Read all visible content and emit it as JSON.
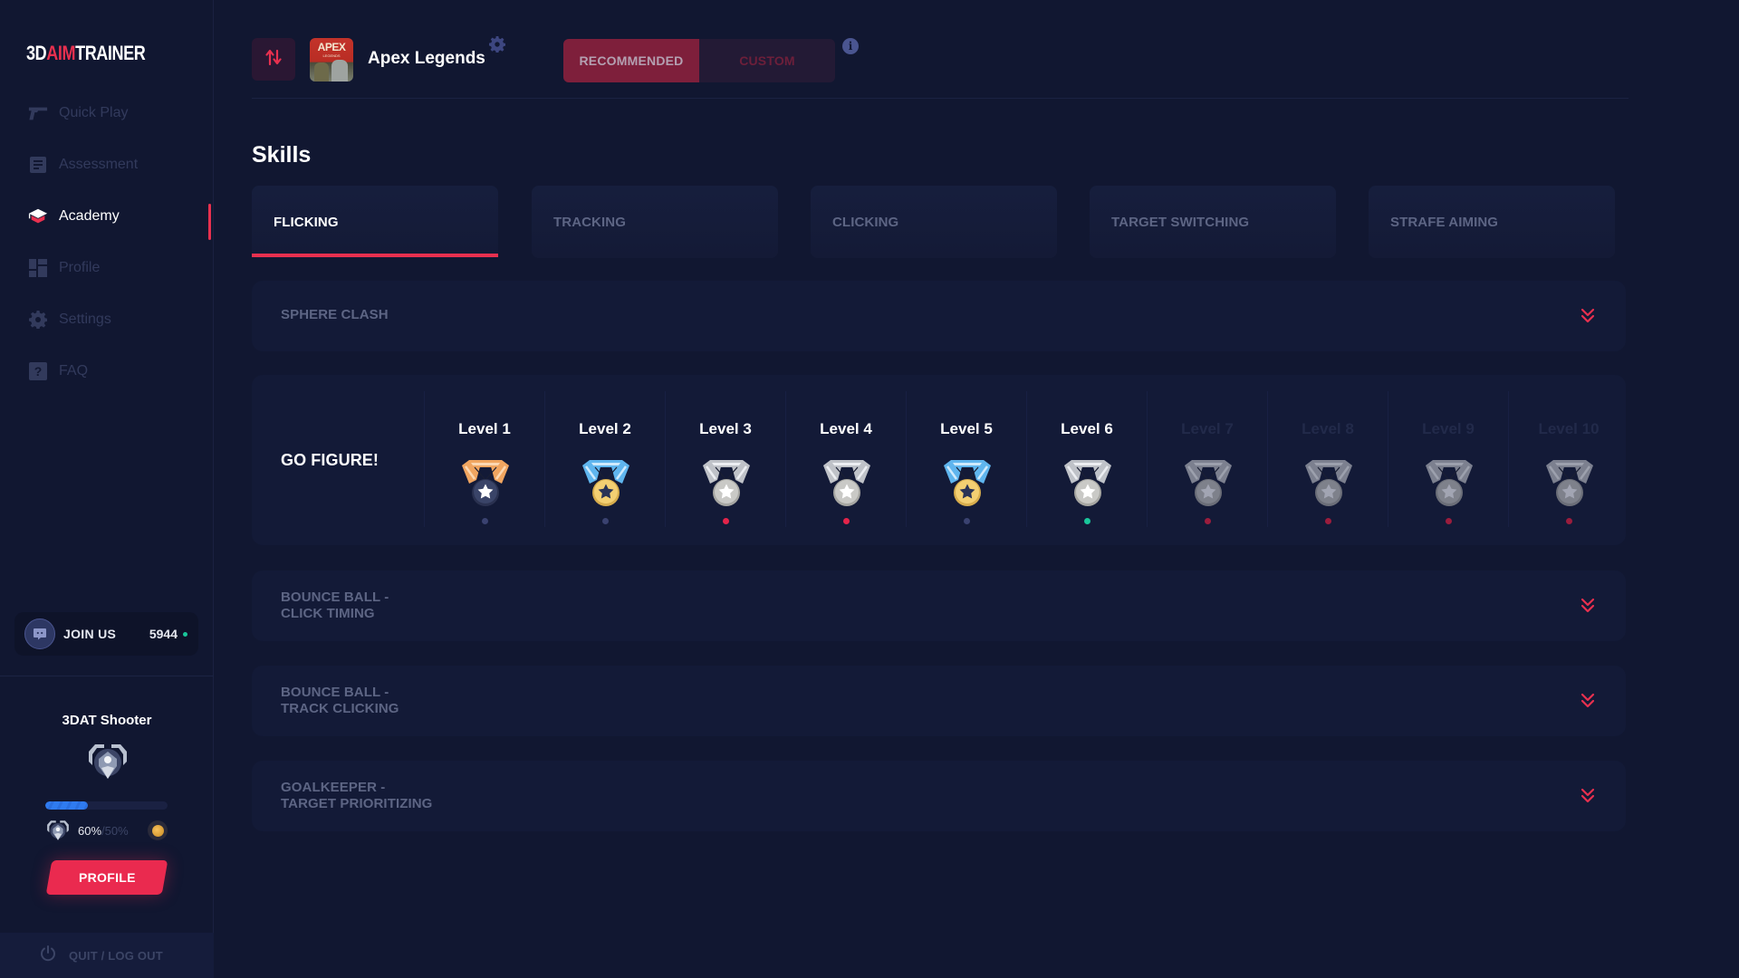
{
  "app": {
    "logo": {
      "part1": "3D",
      "part2": "AIM",
      "part3": "TRAINER"
    }
  },
  "sidebar": {
    "items": [
      {
        "label": "Quick Play",
        "icon": "pistol-icon",
        "active": false
      },
      {
        "label": "Assessment",
        "icon": "document-icon",
        "active": false
      },
      {
        "label": "Academy",
        "icon": "graduation-cap-icon",
        "active": true
      },
      {
        "label": "Profile",
        "icon": "dashboard-icon",
        "active": false
      },
      {
        "label": "Settings",
        "icon": "gear-icon",
        "active": false
      },
      {
        "label": "FAQ",
        "icon": "question-icon",
        "active": false
      }
    ],
    "discord": {
      "label": "JOIN US",
      "online_count": "5944",
      "icon": "discord-icon"
    },
    "rank": {
      "title": "3DAT Shooter",
      "progress_percent": 35,
      "current_percent": "60%",
      "target_percent": "/50%"
    },
    "profile_button": "PROFILE",
    "quit_button": "QUIT / LOG OUT"
  },
  "header": {
    "game_thumb": {
      "title": "APEX",
      "subtitle": "LEGENDS"
    },
    "game_name": "Apex Legends",
    "mode_options": [
      {
        "label": "RECOMMENDED",
        "selected": true
      },
      {
        "label": "CUSTOM",
        "selected": false
      }
    ],
    "info_glyph": "i"
  },
  "skills": {
    "title": "Skills",
    "tabs": [
      {
        "label": "FLICKING",
        "active": true
      },
      {
        "label": "TRACKING",
        "active": false
      },
      {
        "label": "CLICKING",
        "active": false
      },
      {
        "label": "TARGET SWITCHING",
        "active": false
      },
      {
        "label": "STRAFE AIMING",
        "active": false
      }
    ],
    "exercises": [
      {
        "name_line1": "SPHERE CLASH",
        "name_line2": "",
        "expanded": false
      },
      {
        "name_line1": "GO FIGURE!",
        "name_line2": "",
        "expanded": true
      },
      {
        "name_line1": "BOUNCE BALL -",
        "name_line2": "CLICK TIMING",
        "expanded": false
      },
      {
        "name_line1": "BOUNCE BALL -",
        "name_line2": "TRACK CLICKING",
        "expanded": false
      },
      {
        "name_line1": "GOALKEEPER -",
        "name_line2": "TARGET PRIORITIZING",
        "expanded": false
      }
    ],
    "levels": [
      {
        "label": "Level 1",
        "medal": "bronze",
        "status": "neutral",
        "locked": false
      },
      {
        "label": "Level 2",
        "medal": "gold",
        "status": "neutral",
        "locked": false
      },
      {
        "label": "Level 3",
        "medal": "silver",
        "status": "fail",
        "locked": false
      },
      {
        "label": "Level 4",
        "medal": "silver",
        "status": "fail",
        "locked": false
      },
      {
        "label": "Level 5",
        "medal": "gold",
        "status": "neutral",
        "locked": false
      },
      {
        "label": "Level 6",
        "medal": "silver",
        "status": "pass",
        "locked": false
      },
      {
        "label": "Level 7",
        "medal": "locked",
        "status": "fail",
        "locked": true
      },
      {
        "label": "Level 8",
        "medal": "locked",
        "status": "fail",
        "locked": true
      },
      {
        "label": "Level 9",
        "medal": "locked",
        "status": "fail",
        "locked": true
      },
      {
        "label": "Level 10",
        "medal": "locked",
        "status": "fail",
        "locked": true
      }
    ]
  },
  "colors": {
    "accent": "#e8304f",
    "background": "#111731",
    "card": "#131a37",
    "pass": "#19c69a",
    "neutral": "#3a4270",
    "fail": "#e3244a",
    "fail_dim": "#9b1d3d",
    "xp_bar": "#2f7bf0"
  }
}
